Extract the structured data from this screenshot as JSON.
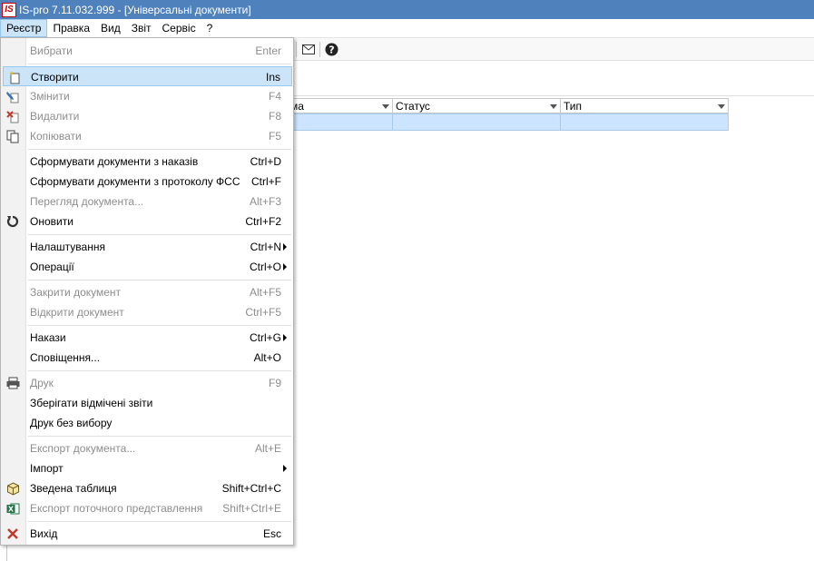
{
  "window": {
    "title": "IS-pro 7.11.032.999 - [Універсальні документи]",
    "logo_text": "IS"
  },
  "menubar": {
    "items": [
      {
        "label": "Реєстр",
        "active": true
      },
      {
        "label": "Правка"
      },
      {
        "label": "Вид"
      },
      {
        "label": "Звіт"
      },
      {
        "label": "Сервіс"
      },
      {
        "label": "?"
      }
    ]
  },
  "grid": {
    "columns": [
      {
        "label": "ма"
      },
      {
        "label": "Статус"
      },
      {
        "label": "Тип"
      }
    ]
  },
  "dropdown": {
    "items": [
      {
        "label": "Вибрати",
        "shortcut": "Enter",
        "disabled": true
      },
      {
        "label": "Створити",
        "shortcut": "Ins",
        "icon": "create-doc-icon",
        "highlighted": true
      },
      {
        "label": "Змінити",
        "shortcut": "F4",
        "icon": "edit-doc-icon",
        "disabled": true
      },
      {
        "label": "Видалити",
        "shortcut": "F8",
        "icon": "delete-doc-icon",
        "disabled": true
      },
      {
        "label": "Копіювати",
        "shortcut": "F5",
        "icon": "copy-icon",
        "disabled": true
      },
      {
        "label": "Сформувати документи з наказів",
        "shortcut": "Ctrl+D"
      },
      {
        "label": "Сформувати документи з протоколу ФСС",
        "shortcut": "Ctrl+F"
      },
      {
        "label": "Перегляд документа...",
        "shortcut": "Alt+F3",
        "disabled": true
      },
      {
        "label": "Оновити",
        "shortcut": "Ctrl+F2",
        "icon": "refresh-icon"
      },
      {
        "label": "Налаштування",
        "shortcut": "Ctrl+N",
        "submenu": true
      },
      {
        "label": "Операції",
        "shortcut": "Ctrl+O",
        "submenu": true
      },
      {
        "label": "Закрити документ",
        "shortcut": "Alt+F5",
        "disabled": true
      },
      {
        "label": "Відкрити документ",
        "shortcut": "Ctrl+F5",
        "disabled": true
      },
      {
        "label": "Накази",
        "shortcut": "Ctrl+G",
        "submenu": true
      },
      {
        "label": "Сповіщення...",
        "shortcut": "Alt+O"
      },
      {
        "label": "Друк",
        "shortcut": "F9",
        "icon": "printer-icon",
        "disabled": true
      },
      {
        "label": "Зберігати відмічені звіти",
        "shortcut": ""
      },
      {
        "label": "Друк без вибору",
        "shortcut": ""
      },
      {
        "label": "Експорт документа...",
        "shortcut": "Alt+E",
        "disabled": true
      },
      {
        "label": "Імпорт",
        "shortcut": "",
        "submenu": true
      },
      {
        "label": "Зведена таблиця",
        "shortcut": "Shift+Ctrl+C",
        "icon": "pivot-table-icon"
      },
      {
        "label": "Експорт поточного представлення",
        "shortcut": "Shift+Ctrl+E",
        "icon": "excel-export-icon",
        "disabled": true
      },
      {
        "label": "Вихід",
        "shortcut": "Esc",
        "icon": "exit-icon"
      }
    ]
  }
}
